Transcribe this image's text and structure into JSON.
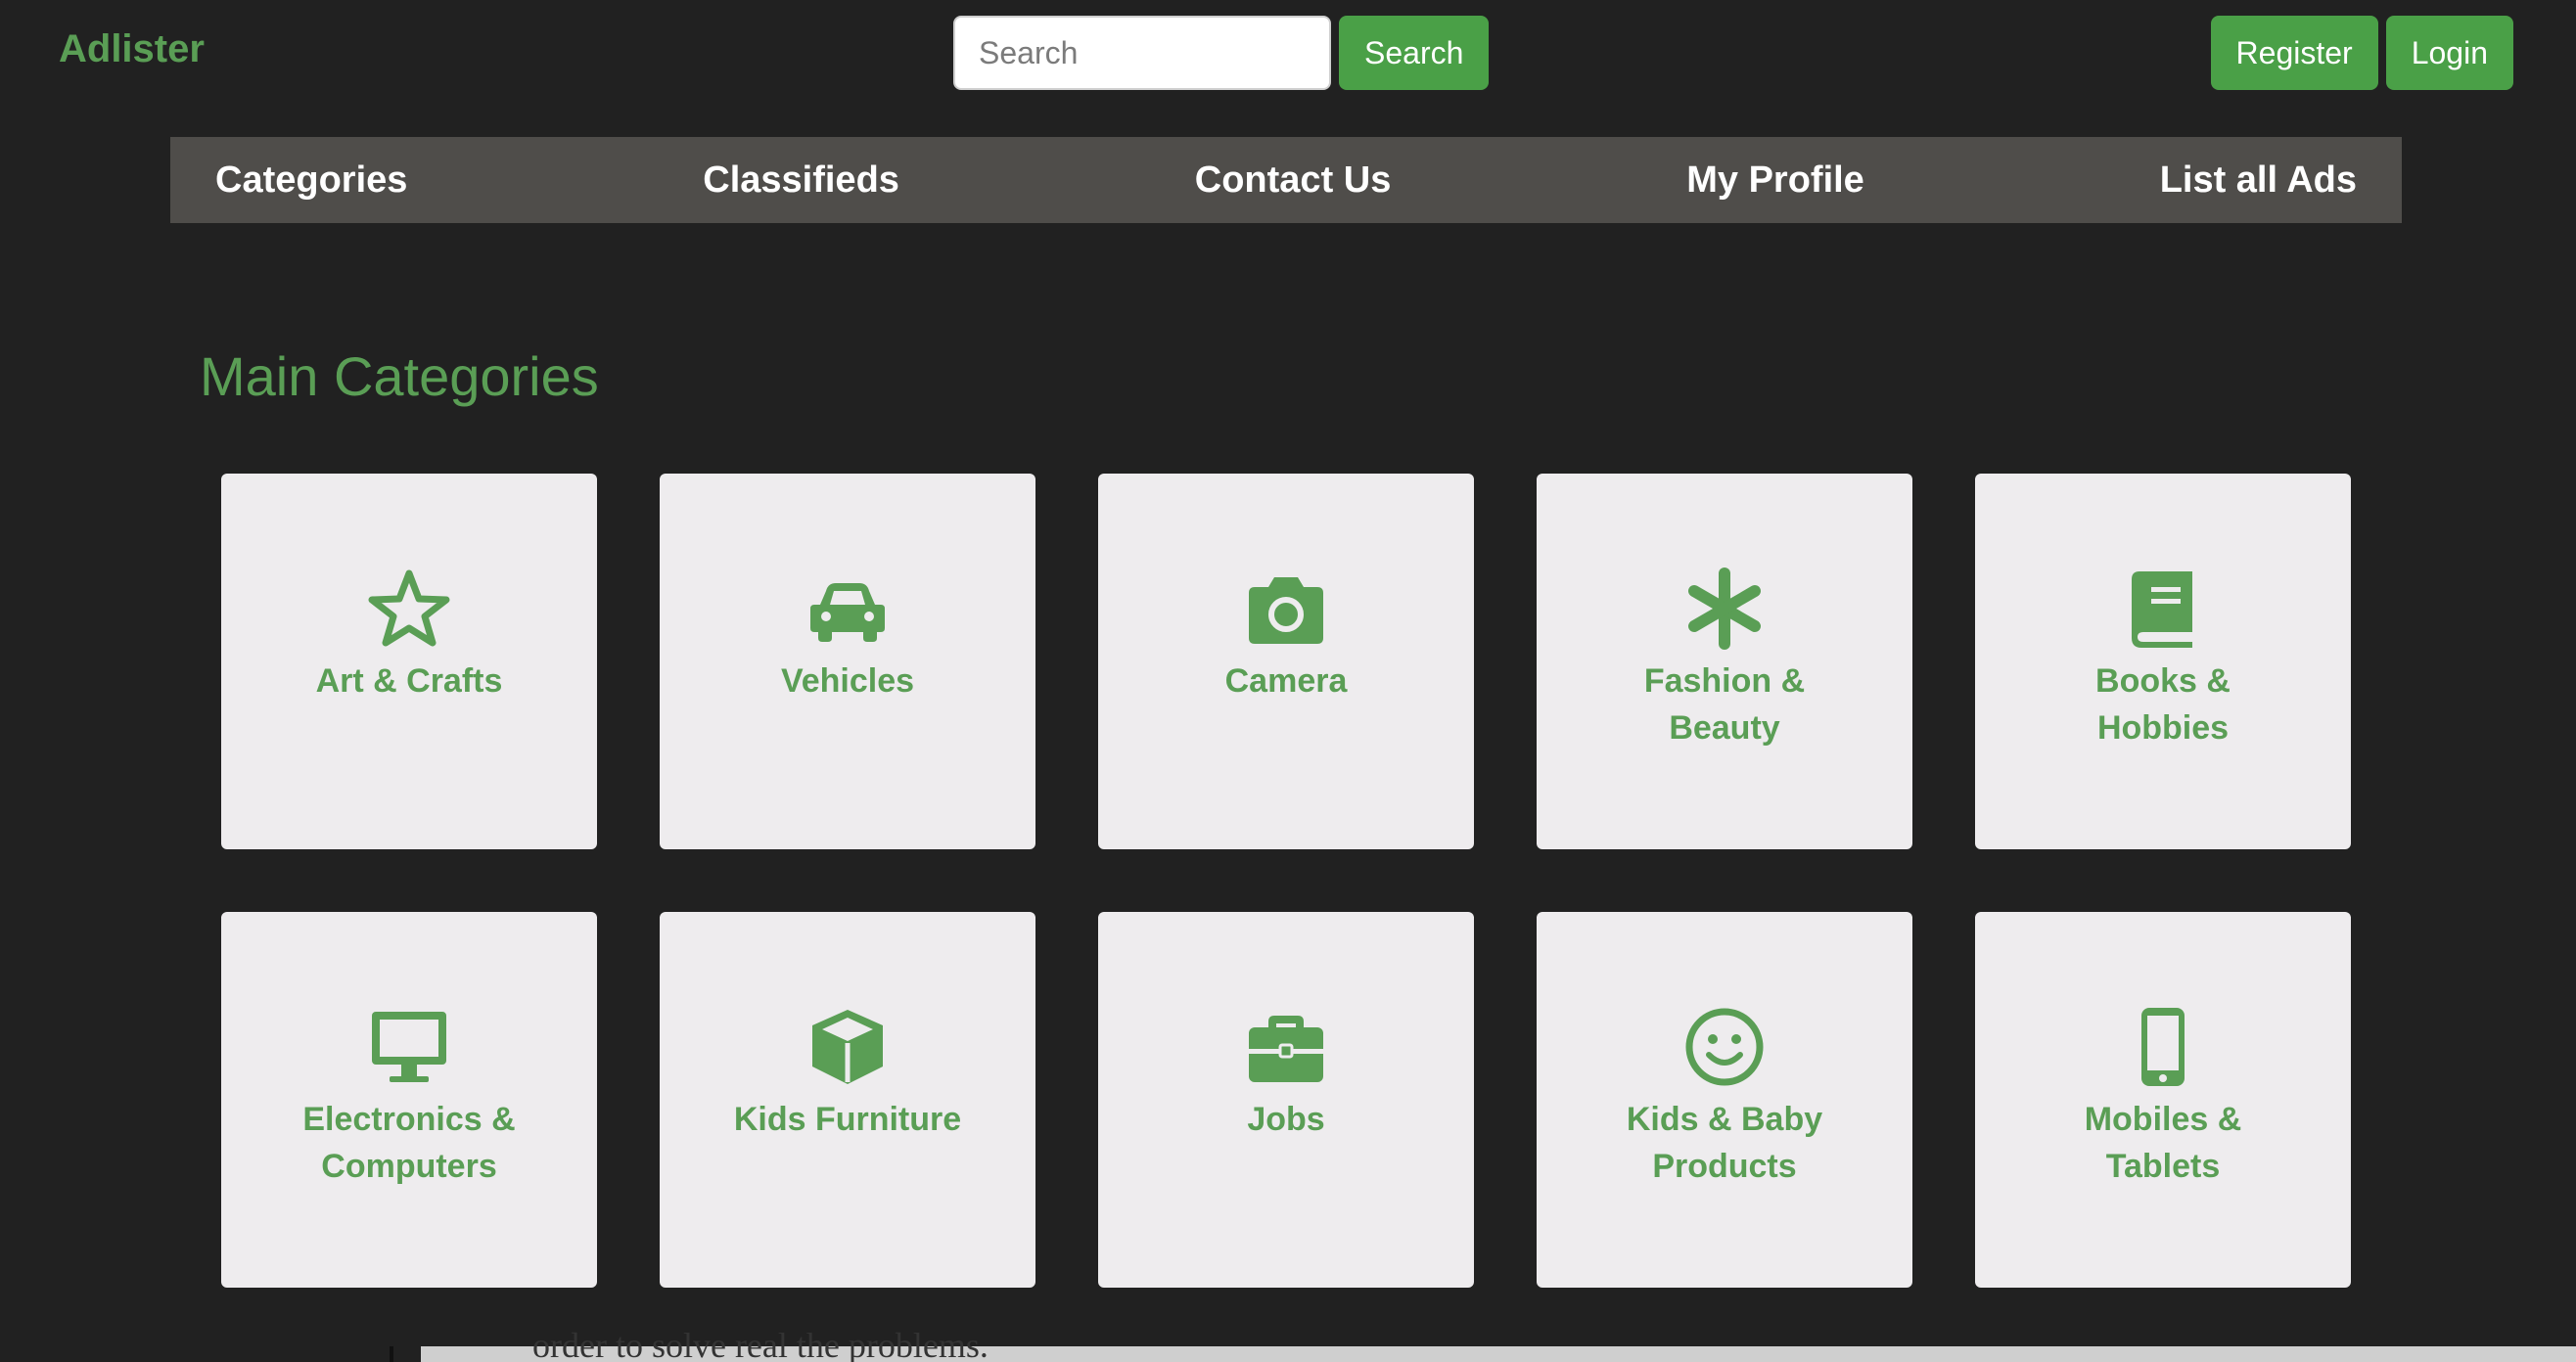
{
  "brand": "Adlister",
  "search": {
    "placeholder": "Search",
    "button": "Search"
  },
  "auth": {
    "register": "Register",
    "login": "Login"
  },
  "nav": [
    "Categories",
    "Classifieds",
    "Contact Us",
    "My Profile",
    "List all Ads"
  ],
  "section_title": "Main Categories",
  "categories": [
    {
      "line1": "Art & Crafts",
      "line2": "",
      "icon": "star-icon"
    },
    {
      "line1": "Vehicles",
      "line2": "",
      "icon": "car-icon"
    },
    {
      "line1": "Camera",
      "line2": "",
      "icon": "camera-icon"
    },
    {
      "line1": "Fashion &",
      "line2": "Beauty",
      "icon": "asterisk-icon"
    },
    {
      "line1": "Books &",
      "line2": "Hobbies",
      "icon": "book-icon"
    },
    {
      "line1": "Electronics &",
      "line2": "Computers",
      "icon": "desktop-icon"
    },
    {
      "line1": "Kids Furniture",
      "line2": "",
      "icon": "cube-icon"
    },
    {
      "line1": "Jobs",
      "line2": "",
      "icon": "briefcase-icon"
    },
    {
      "line1": "Kids & Baby",
      "line2": "Products",
      "icon": "smile-icon"
    },
    {
      "line1": "Mobiles &",
      "line2": "Tablets",
      "icon": "mobile-icon"
    }
  ],
  "bottom_text": "order to solve real the problems.",
  "colors": {
    "accent": "#5a9e55",
    "button": "#4aa047",
    "background": "#212121",
    "nav": "#4f4d4a",
    "card": "#eeecee"
  }
}
